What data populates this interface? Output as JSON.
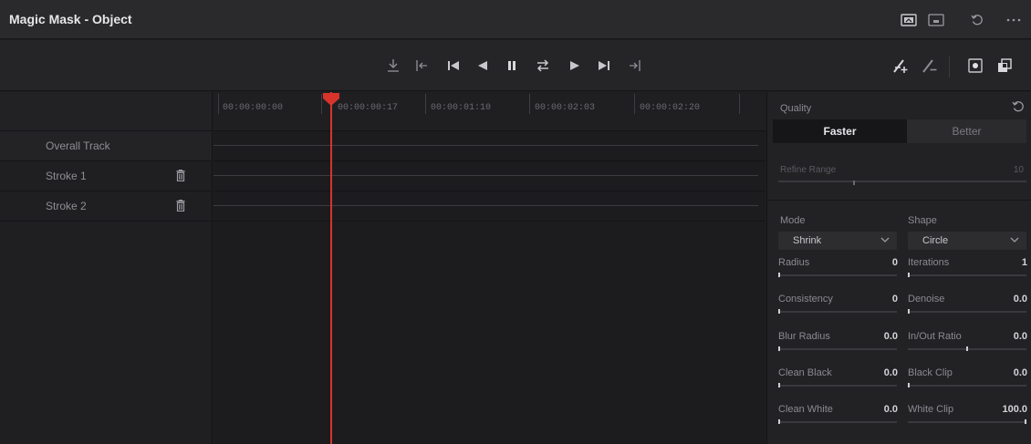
{
  "window": {
    "title": "Magic Mask - Object",
    "icons": [
      "viewer-icon",
      "clip-icon",
      "reset-icon",
      "more-icon"
    ]
  },
  "toolbar": {
    "transport": [
      "track-in-icon",
      "go-to-in-icon",
      "skip-to-start-icon",
      "play-reverse-icon",
      "pause-icon",
      "loop-icon",
      "play-forward-icon",
      "skip-to-end-icon",
      "go-to-out-icon"
    ],
    "tools": [
      "add-stroke-icon",
      "subtract-stroke-icon",
      "show-mask-icon",
      "overlay-icon"
    ]
  },
  "tracks": [
    {
      "name": "Overall Track",
      "deletable": false
    },
    {
      "name": "Stroke 1",
      "deletable": true
    },
    {
      "name": "Stroke 2",
      "deletable": true
    }
  ],
  "timeline": {
    "timecodes": [
      "00:00:00:00",
      "00:00:00:17",
      "00:00:01:10",
      "00:00:02:03",
      "00:00:02:20"
    ],
    "playhead_timecode": "00:00:00:17"
  },
  "inspector": {
    "quality_label": "Quality",
    "quality_options": [
      "Faster",
      "Better"
    ],
    "quality_selected": "Faster",
    "refine_range_label": "Refine Range",
    "refine_range_value": "10",
    "mode_label": "Mode",
    "mode_value": "Shrink",
    "shape_label": "Shape",
    "shape_value": "Circle",
    "params_left": [
      {
        "label": "Radius",
        "value": "0",
        "fraction": 0.0
      },
      {
        "label": "Consistency",
        "value": "0",
        "fraction": 0.0
      },
      {
        "label": "Blur Radius",
        "value": "0.0",
        "fraction": 0.0
      },
      {
        "label": "Clean Black",
        "value": "0.0",
        "fraction": 0.0
      },
      {
        "label": "Clean White",
        "value": "0.0",
        "fraction": 0.0
      }
    ],
    "params_right": [
      {
        "label": "Iterations",
        "value": "1",
        "fraction": 0.0
      },
      {
        "label": "Denoise",
        "value": "0.0",
        "fraction": 0.0
      },
      {
        "label": "In/Out Ratio",
        "value": "0.0",
        "fraction": 0.5
      },
      {
        "label": "Black Clip",
        "value": "0.0",
        "fraction": 0.0
      },
      {
        "label": "White Clip",
        "value": "100.0",
        "fraction": 1.0
      }
    ]
  },
  "colors": {
    "accent_red": "#d8342c",
    "background": "#1e1e20"
  }
}
